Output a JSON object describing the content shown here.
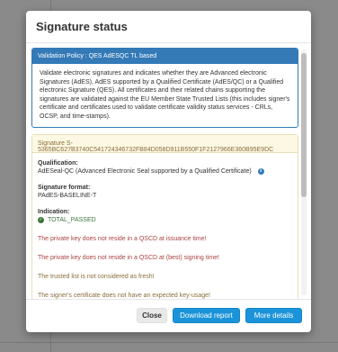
{
  "modal": {
    "title": "Signature status"
  },
  "policy": {
    "heading": "Validation Policy : QES AdESQC TL based",
    "description": "Validate electronic signatures and indicates whether they are Advanced electronic Signatures (AdES), AdES supported by a Qualified Certificate (AdES/QC) or a Qualified electronic Signature (QES). All certificates and their related chains supporting the signatures are validated against the EU Member State Trusted Lists (this includes signer's certificate and certificates used to validate certificate validity status services - CRLs, OCSP, and time-stamps)."
  },
  "signature": {
    "heading": "Signature S-5365BC627B3740C541724346732FB84D058D911B550F1F2127966E360B95E9DC",
    "qualification_label": "Qualification:",
    "qualification_value": "AdESeal-QC (Advanced Electronic Seal supported by a Qualified Certificate)",
    "format_label": "Signature format:",
    "format_value": "PAdES-BASELINE-T",
    "indication_label": "Indication:",
    "indication_value": "TOTAL_PASSED",
    "messages": [
      {
        "text": "The private key does not reside in a QSCD at issuance time!",
        "level": "error"
      },
      {
        "text": "The private key does not reside in a QSCD at (best) signing time!",
        "level": "error"
      },
      {
        "text": "The trusted list is not considered as fresh!",
        "level": "warning"
      },
      {
        "text": "The signer's certificate does not have an expected key-usage!",
        "level": "warning"
      }
    ]
  },
  "icons": {
    "info": "info-circle-icon",
    "check": "check-circle-icon"
  },
  "footer": {
    "close_label": "Close",
    "download_label": "Download report",
    "more_label": "More details"
  },
  "colors": {
    "primary": "#337ab7",
    "button_primary": "#1a93d9",
    "success": "#3c763d",
    "error": "#a94442",
    "warning": "#8a6d3b",
    "warning_bg": "#fcf8e3"
  }
}
